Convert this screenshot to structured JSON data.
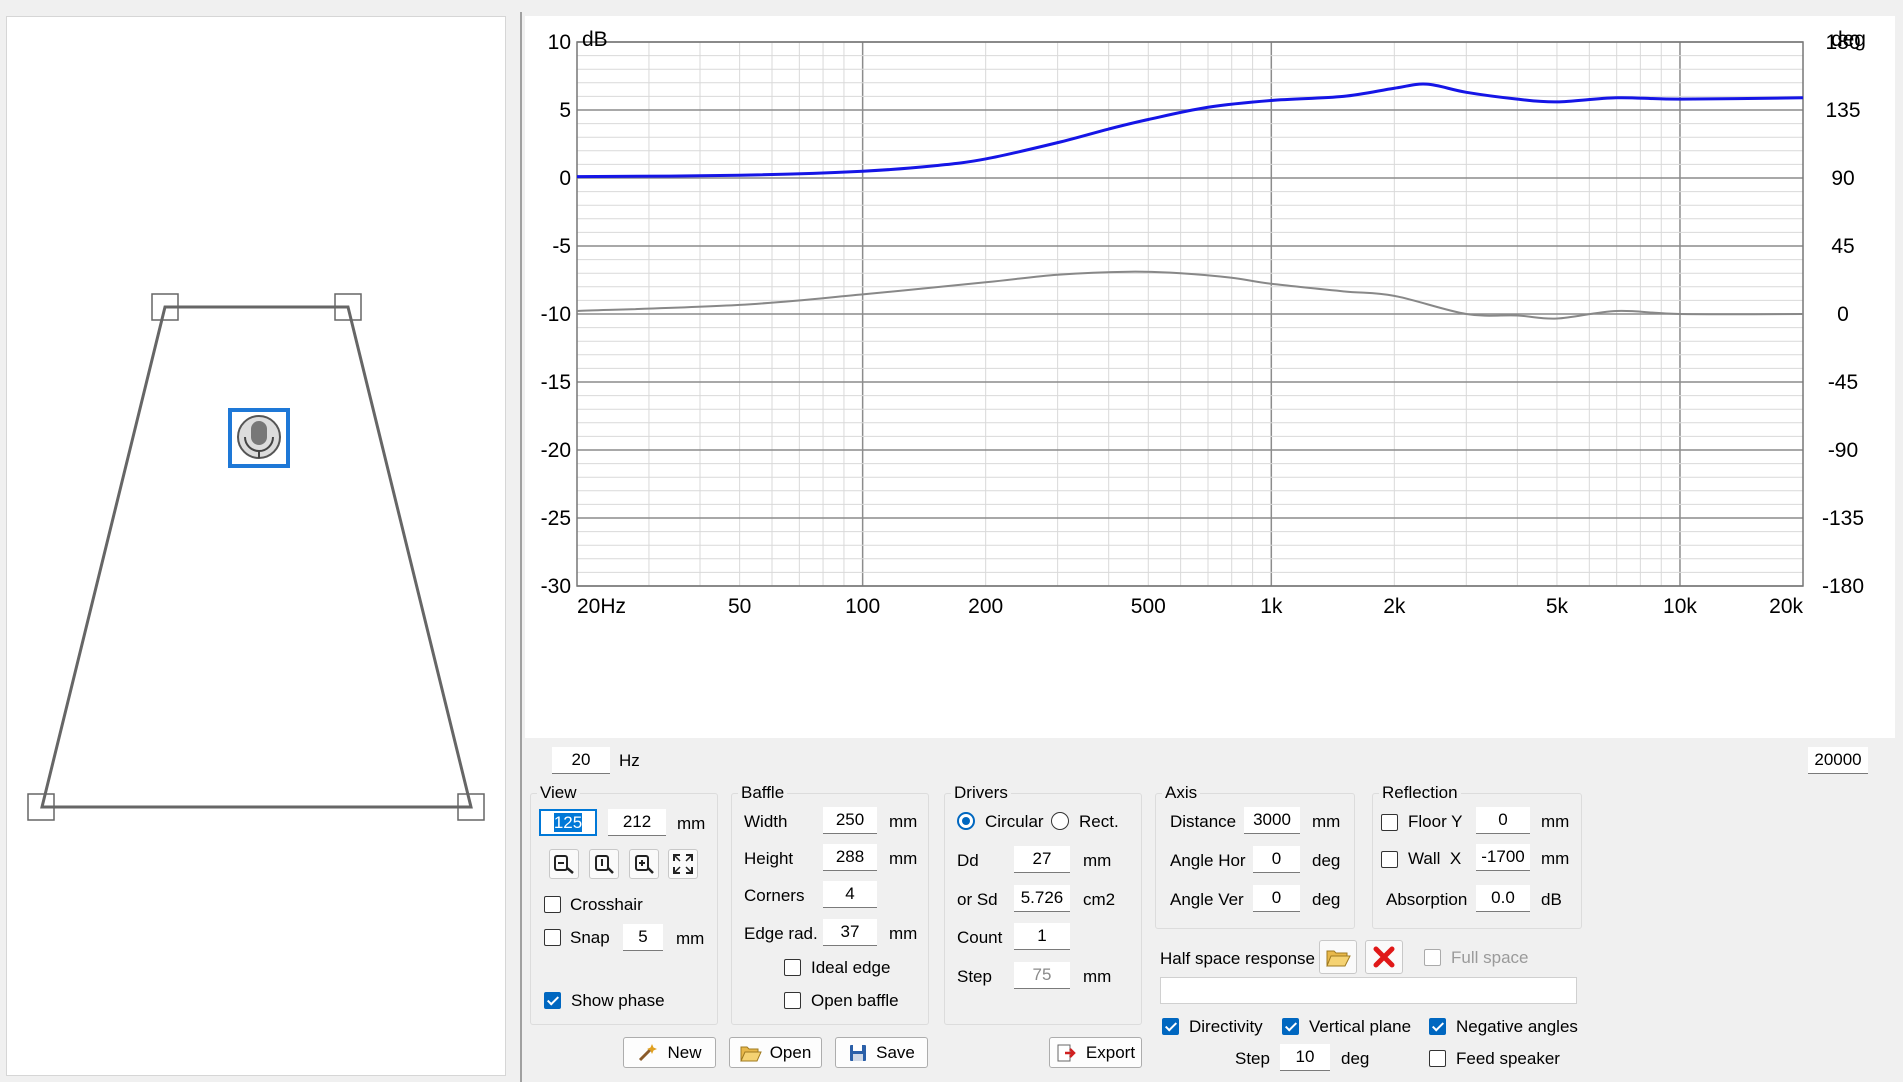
{
  "chart": {
    "left_unit": "dB",
    "right_unit": "deg",
    "y_ticks_db": [
      "10",
      "5",
      "0",
      "-5",
      "-10",
      "-15",
      "-20",
      "-25",
      "-30"
    ],
    "y_ticks_deg": [
      "180",
      "135",
      "90",
      "45",
      "0",
      "-45",
      "-90",
      "-135",
      "-180"
    ],
    "x_ticks": [
      "20Hz",
      "50",
      "100",
      "200",
      "500",
      "1k",
      "2k",
      "5k",
      "10k",
      "20k"
    ],
    "colors": {
      "magnitude": "#1515e6",
      "phase": "#888888",
      "grid_major": "#8c8c8c",
      "grid_minor": "#d9d9d9"
    }
  },
  "chart_data": {
    "type": "line",
    "xscale": "log",
    "xlim": [
      20,
      20000
    ],
    "ylim": [
      -30,
      10
    ],
    "ylim_right": [
      -180,
      180
    ],
    "ylabel": "dB",
    "ylabel_right": "deg",
    "grid": true,
    "series": [
      {
        "x": [
          20,
          50,
          100,
          150,
          200,
          300,
          400,
          500,
          700,
          1000,
          1500,
          2000,
          2400,
          3000,
          4000,
          5000,
          7000,
          10000,
          20000
        ],
        "y": [
          0.1,
          0.2,
          0.5,
          0.9,
          1.4,
          2.6,
          3.6,
          4.3,
          5.2,
          5.7,
          6.0,
          6.6,
          6.9,
          6.3,
          5.8,
          5.6,
          5.9,
          5.8,
          5.9
        ]
      },
      {
        "x": [
          20,
          50,
          100,
          200,
          300,
          450,
          600,
          800,
          1000,
          1500,
          2000,
          3000,
          4000,
          5000,
          7000,
          10000,
          20000
        ],
        "y": [
          2,
          6,
          13,
          21,
          26,
          28,
          27,
          24,
          20,
          15,
          12,
          0,
          -1,
          -3,
          2,
          0,
          0
        ]
      }
    ]
  },
  "freq": {
    "min": "20",
    "max": "20000",
    "unit": "Hz"
  },
  "view": {
    "title": "View",
    "x": "125",
    "y": "212",
    "unit": "mm",
    "crosshair": "Crosshair",
    "snap": "Snap",
    "snap_value": "5",
    "snap_unit": "mm",
    "show_phase": "Show phase"
  },
  "baffle": {
    "title": "Baffle",
    "width_label": "Width",
    "width": "250",
    "height_label": "Height",
    "height": "288",
    "corners_label": "Corners",
    "corners": "4",
    "edge_label": "Edge rad.",
    "edge": "37",
    "mm": "mm",
    "ideal_edge": "Ideal edge",
    "open_baffle": "Open baffle"
  },
  "drivers": {
    "title": "Drivers",
    "circular": "Circular",
    "rect": "Rect.",
    "dd_label": "Dd",
    "dd": "27",
    "dd_unit": "mm",
    "sd_label": "or Sd",
    "sd": "5.726",
    "sd_unit": "cm2",
    "count_label": "Count",
    "count": "1",
    "step_label": "Step",
    "step": "75",
    "step_unit": "mm"
  },
  "axis": {
    "title": "Axis",
    "distance_label": "Distance",
    "distance": "3000",
    "distance_unit": "mm",
    "angle_hor_label": "Angle Hor",
    "angle_hor": "0",
    "angle_ver_label": "Angle Ver",
    "angle_ver": "0",
    "deg": "deg"
  },
  "reflection": {
    "title": "Reflection",
    "floor_label": "Floor Y",
    "floor": "0",
    "floor_unit": "mm",
    "wall_label": "Wall  X",
    "wall": "-1700",
    "wall_unit": "mm",
    "absorption_label": "Absorption",
    "absorption": "0.0",
    "absorption_unit": "dB"
  },
  "half_space": {
    "label": "Half space response",
    "full_space": "Full space",
    "path": ""
  },
  "directivity": {
    "directivity": "Directivity",
    "vertical_plane": "Vertical plane",
    "negative_angles": "Negative angles",
    "step_label": "Step",
    "step": "10",
    "step_unit": "deg",
    "feed_speaker": "Feed speaker"
  },
  "buttons": {
    "new": "New",
    "open": "Open",
    "save": "Save",
    "export": "Export"
  }
}
